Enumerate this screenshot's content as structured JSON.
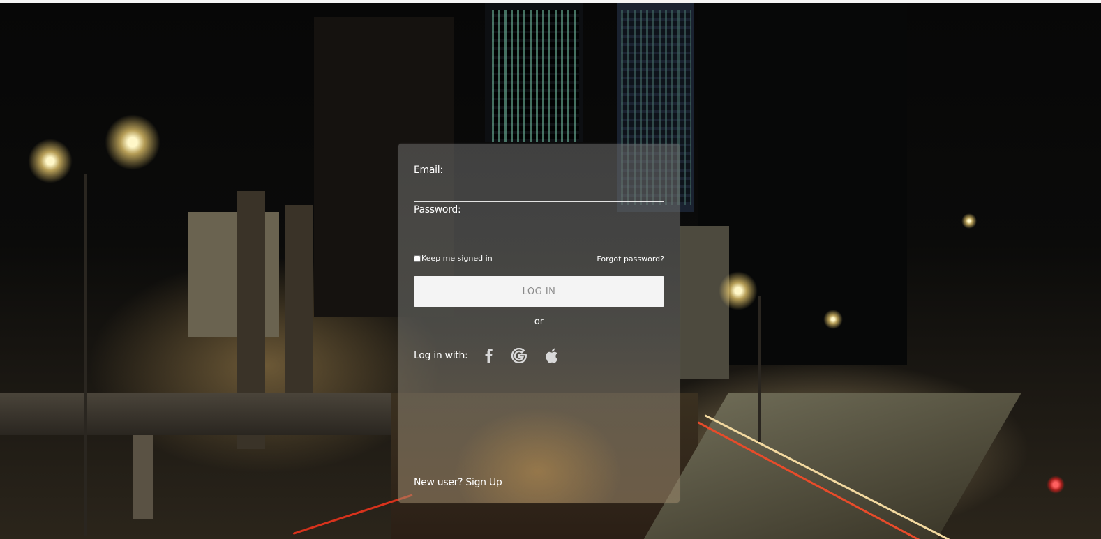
{
  "form": {
    "email_label": "Email:",
    "password_label": "Password:",
    "remember_label": "Keep me signed in",
    "remember_checked": false,
    "forgot_label": "Forgot password?",
    "login_label": "LOG IN",
    "or_label": "or",
    "social_label": "Log in with:",
    "social_icons": [
      "facebook-icon",
      "google-icon",
      "apple-icon"
    ],
    "signup_prefix": "New user?",
    "signup_link": "Sign Up"
  },
  "colors": {
    "button_bg": "#f4f4f4",
    "button_text": "#8a8a8a",
    "text": "#ffffff"
  }
}
